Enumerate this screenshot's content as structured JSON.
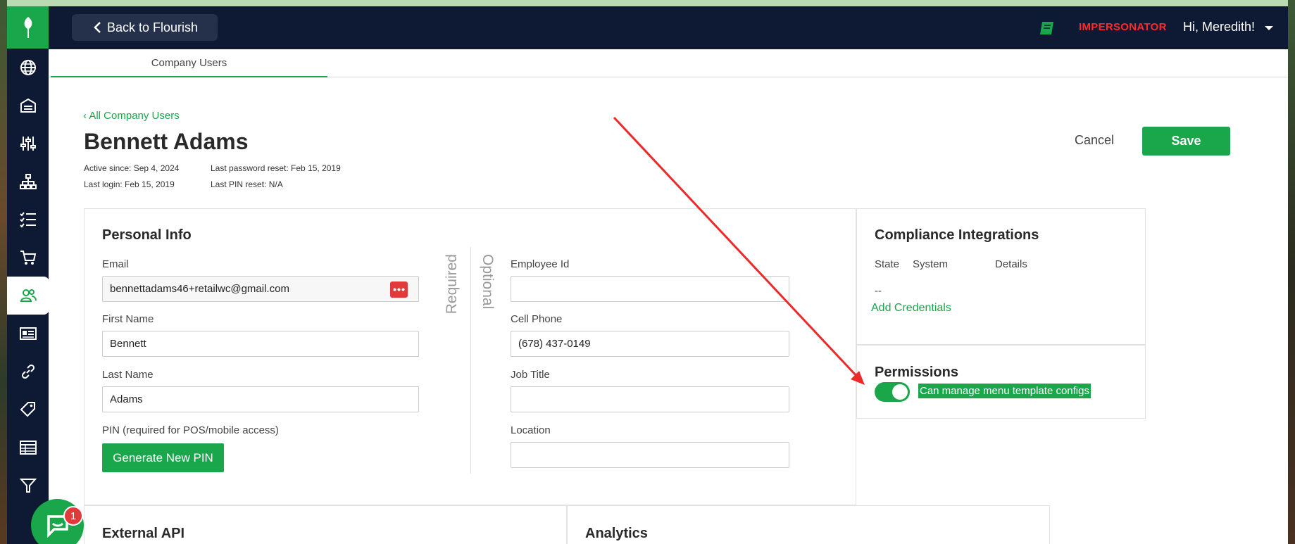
{
  "topbar": {
    "back_label": "Back to Flourish",
    "impersonator": "IMPERSONATOR",
    "greeting": "Hi, Meredith!"
  },
  "subtabs": {
    "active": "Company Users"
  },
  "breadcrumb": "All Company Users",
  "user": {
    "name": "Bennett Adams",
    "active_since": "Active since: Sep 4, 2024",
    "last_login": "Last login: Feb 15, 2019",
    "last_password_reset": "Last password reset: Feb 15, 2019",
    "last_pin_reset": "Last PIN reset: N/A"
  },
  "actions": {
    "cancel": "Cancel",
    "save": "Save"
  },
  "personal_info": {
    "title": "Personal Info",
    "required_label": "Required",
    "optional_label": "Optional",
    "email_label": "Email",
    "email_value": "bennettadams46+retailwc@gmail.com",
    "first_name_label": "First Name",
    "first_name_value": "Bennett",
    "last_name_label": "Last Name",
    "last_name_value": "Adams",
    "pin_label": "PIN (required for POS/mobile access)",
    "generate_pin": "Generate New PIN",
    "employee_id_label": "Employee Id",
    "employee_id_value": "",
    "cell_phone_label": "Cell Phone",
    "cell_phone_value": "(678) 437-0149",
    "job_title_label": "Job Title",
    "job_title_value": "",
    "location_label": "Location",
    "location_value": ""
  },
  "compliance": {
    "title": "Compliance Integrations",
    "columns": [
      "State",
      "System",
      "Details"
    ],
    "empty": "--",
    "add_credentials": "Add Credentials"
  },
  "permissions": {
    "title": "Permissions",
    "toggle_label": "Can manage menu template configs",
    "toggle_on": true
  },
  "external_api": {
    "title": "External API"
  },
  "analytics": {
    "title": "Analytics"
  },
  "chat": {
    "badge_count": "1"
  },
  "colors": {
    "brand_green": "#1aa64a",
    "nav_dark": "#0e1a33",
    "alert_red": "#ff2a2a"
  }
}
